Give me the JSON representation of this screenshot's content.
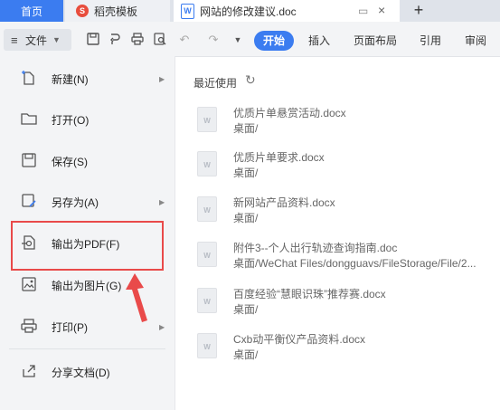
{
  "tabs": {
    "home": "首页",
    "template": "稻壳模板",
    "template_icon": "S",
    "document": "网站的修改建议.doc",
    "document_icon": "W",
    "new_tab": "+"
  },
  "toolbar": {
    "file_label": "文件",
    "ribbon_tabs": [
      "开始",
      "插入",
      "页面布局",
      "引用",
      "审阅"
    ],
    "active_tab": "开始",
    "tools": [
      "save-icon",
      "convert-icon",
      "print-icon",
      "preview-icon",
      "undo-icon",
      "redo-icon",
      "more-icon"
    ]
  },
  "file_menu": {
    "items": [
      {
        "label": "新建(N)",
        "icon": "new-doc-icon",
        "submenu": true
      },
      {
        "label": "打开(O)",
        "icon": "folder-open-icon",
        "submenu": false
      },
      {
        "label": "保存(S)",
        "icon": "save-icon",
        "submenu": false
      },
      {
        "label": "另存为(A)",
        "icon": "save-as-icon",
        "submenu": true
      },
      {
        "label": "输出为PDF(F)",
        "icon": "export-pdf-icon",
        "submenu": false
      },
      {
        "label": "输出为图片(G)",
        "icon": "export-image-icon",
        "submenu": false
      },
      {
        "label": "打印(P)",
        "icon": "print-icon",
        "submenu": true
      },
      {
        "label": "分享文档(D)",
        "icon": "share-icon",
        "submenu": false
      }
    ],
    "highlighted_item": "输出为PDF(F)"
  },
  "recent": {
    "title": "最近使用",
    "files": [
      {
        "name": "优质片单悬赏活动.docx",
        "path": "桌面/"
      },
      {
        "name": "优质片单要求.docx",
        "path": "桌面/"
      },
      {
        "name": "新网站产品资料.docx",
        "path": "桌面/"
      },
      {
        "name": "附件3--个人出行轨迹查询指南.doc",
        "path": "桌面/WeChat Files/dongguavs/FileStorage/File/2..."
      },
      {
        "name": "百度经验“慧眼识珠”推荐赛.docx",
        "path": "桌面/"
      },
      {
        "name": "Cxb动平衡仪产品资料.docx",
        "path": "桌面/"
      }
    ]
  },
  "colors": {
    "accent": "#3b7cf0",
    "annotation": "#e94a4a"
  }
}
